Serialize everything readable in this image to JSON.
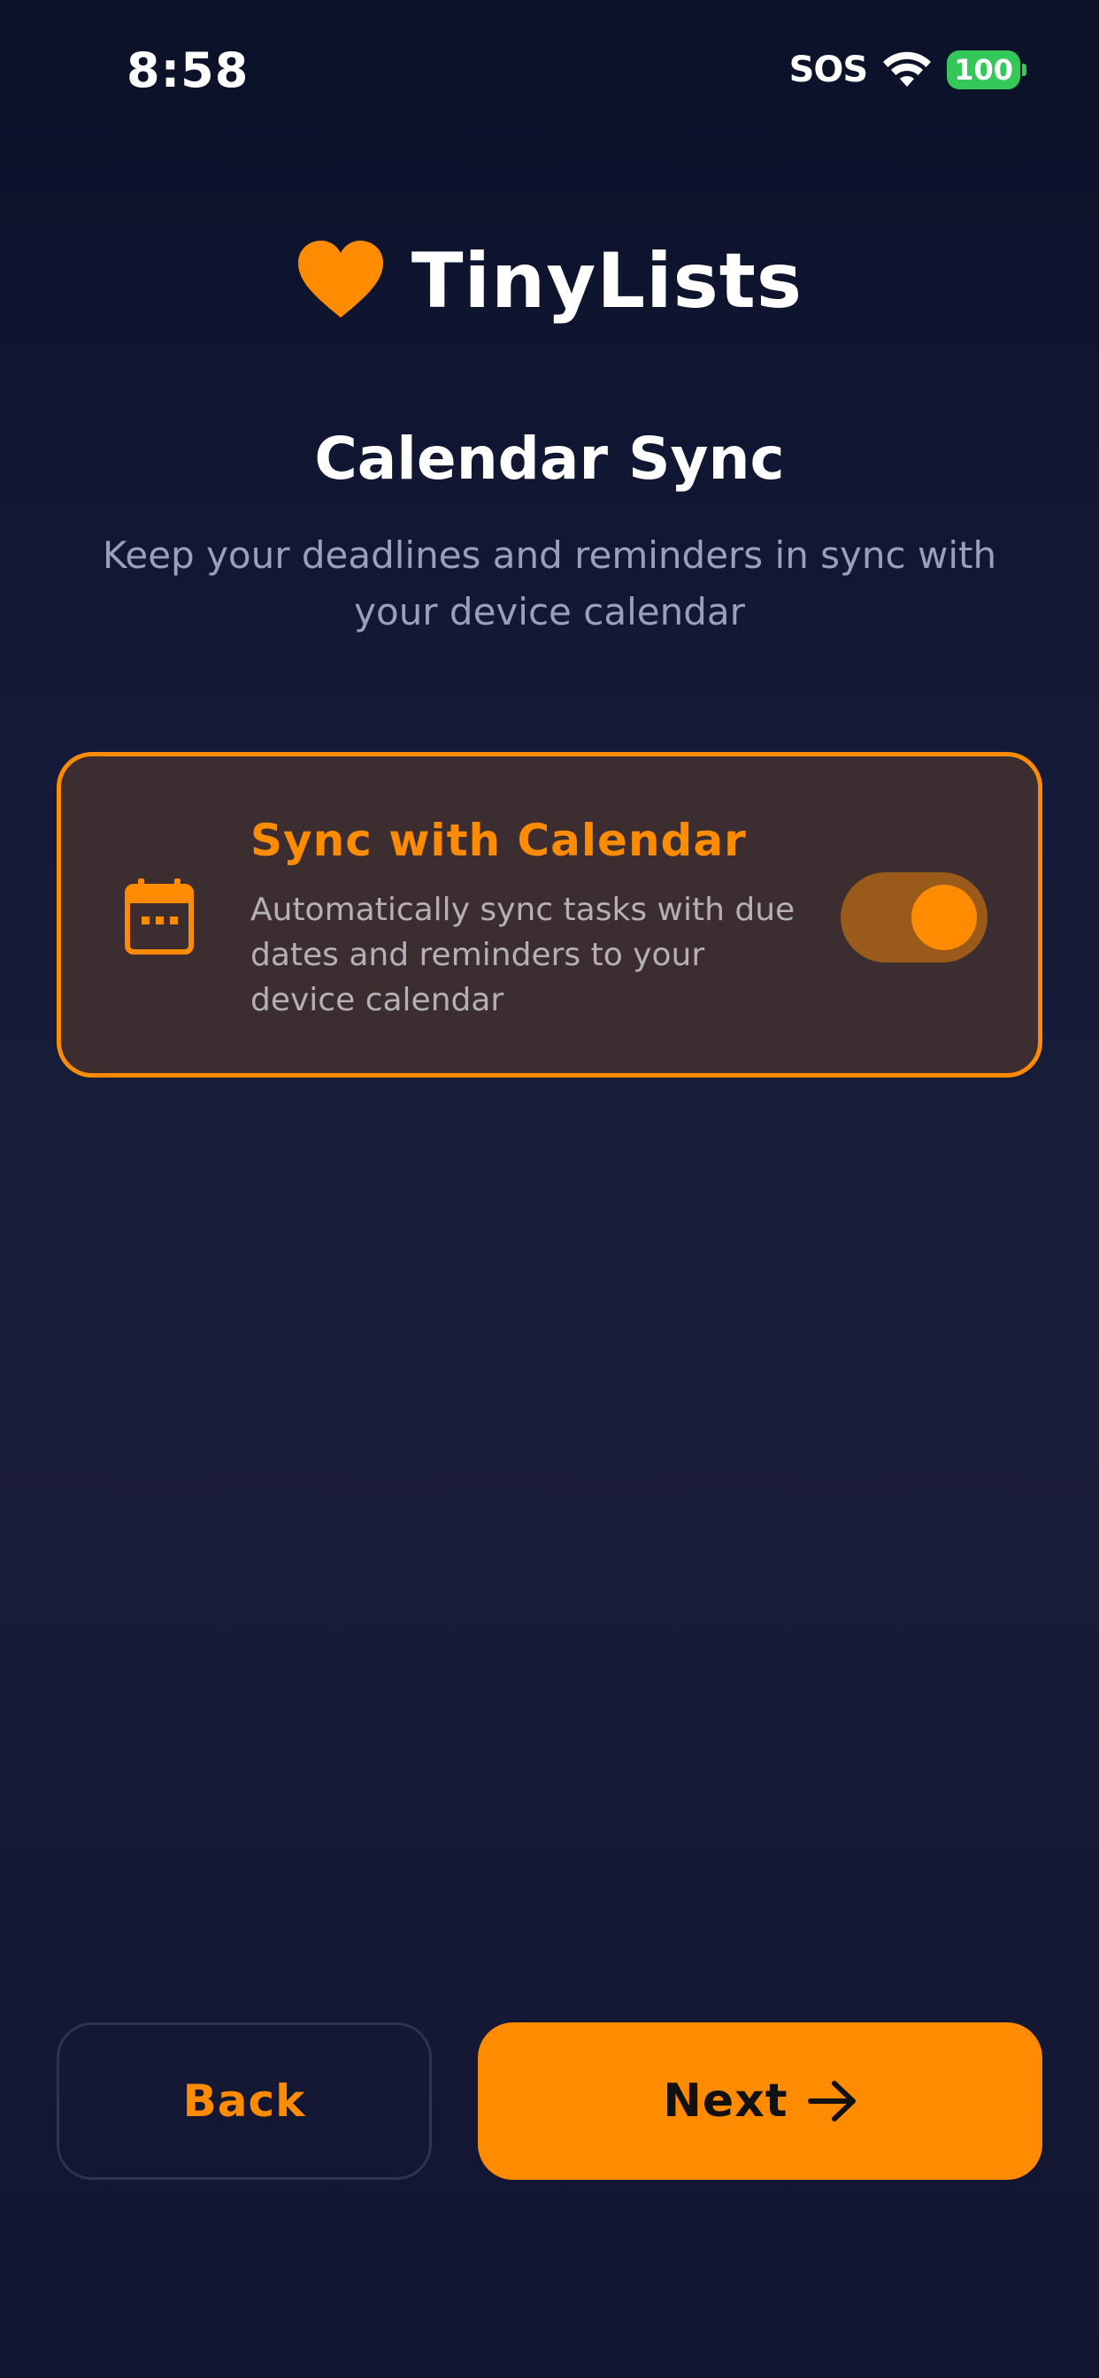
{
  "status_bar": {
    "time": "8:58",
    "sos": "SOS",
    "battery": "100"
  },
  "brand": {
    "name": "TinyLists",
    "icon": "heart-icon",
    "accent_color": "#ff8c00"
  },
  "page": {
    "title": "Calendar Sync",
    "subtitle": "Keep your deadlines and reminders in sync with your device calendar"
  },
  "sync_card": {
    "icon": "calendar-icon",
    "title": "Sync with Calendar",
    "description": "Automatically sync tasks with due dates and reminders to your device calendar",
    "toggle_on": true
  },
  "navigation": {
    "back_label": "Back",
    "next_label": "Next",
    "next_icon": "arrow-right-icon"
  }
}
